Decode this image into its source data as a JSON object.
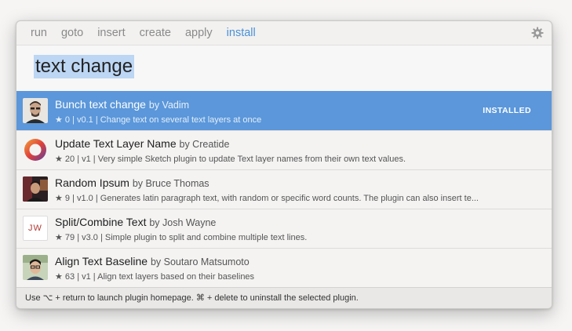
{
  "tabs": [
    {
      "label": "run",
      "active": false
    },
    {
      "label": "goto",
      "active": false
    },
    {
      "label": "insert",
      "active": false
    },
    {
      "label": "create",
      "active": false
    },
    {
      "label": "apply",
      "active": false
    },
    {
      "label": "install",
      "active": true
    }
  ],
  "search": {
    "query": "text change"
  },
  "results": [
    {
      "name": "Bunch text change",
      "by": "by Vadim",
      "meta": "★ 0 | v0.1 | Change text on several text layers at once",
      "badge": "INSTALLED",
      "selected": true,
      "icon": "avatar-photo-icon"
    },
    {
      "name": "Update Text Layer Name",
      "by": "by Creatide",
      "meta": "★ 20 | v1 | Very simple Sketch plugin to update Text layer names from their own text values.",
      "icon": "ring-logo-icon"
    },
    {
      "name": "Random Ipsum",
      "by": "by Bruce Thomas",
      "meta": "★ 9 | v1.0 | Generates latin paragraph text, with random or specific word counts. The plugin can also insert te...",
      "icon": "avatar-photo-icon"
    },
    {
      "name": "Split/Combine Text",
      "by": "by Josh Wayne",
      "meta": "★ 79 | v3.0 | Simple plugin to split and combine multiple text lines.",
      "icon": "jw-logo-icon",
      "logo_text": "JW"
    },
    {
      "name": "Align Text Baseline",
      "by": "by Soutaro Matsumoto",
      "meta": "★ 63 | v1 | Align text layers based on their baselines",
      "icon": "avatar-photo-icon"
    }
  ],
  "footer": {
    "hint": "Use ⌥ + return to launch plugin homepage. ⌘ + delete to uninstall the selected plugin."
  },
  "colors": {
    "accent": "#4a90d9",
    "selected_row": "#5b97da",
    "search_highlight": "#bcd6f4"
  }
}
